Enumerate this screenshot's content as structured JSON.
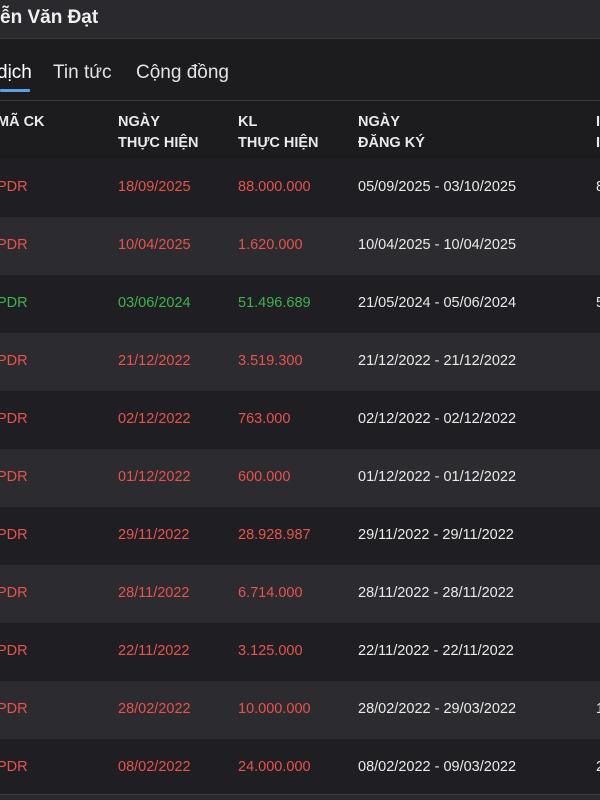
{
  "header": {
    "title": "ễn Văn Đạt"
  },
  "tabs": [
    {
      "label": "dịch",
      "active": true
    },
    {
      "label": "Tin tức",
      "active": false
    },
    {
      "label": "Cộng đồng",
      "active": false
    }
  ],
  "table": {
    "columns": [
      {
        "line1": "MÃ CK",
        "line2": ""
      },
      {
        "line1": "NGÀY",
        "line2": "THỰC HIỆN"
      },
      {
        "line1": "KL",
        "line2": "THỰC HIỆN"
      },
      {
        "line1": "NGÀY",
        "line2": "ĐĂNG KÝ"
      },
      {
        "line1": "I",
        "line2": "I"
      }
    ],
    "rows": [
      {
        "code": "PDR",
        "date": "18/09/2025",
        "volume": "88.000.000",
        "registration": "05/09/2025 - 03/10/2025",
        "extra": "8",
        "status": "red"
      },
      {
        "code": "PDR",
        "date": "10/04/2025",
        "volume": "1.620.000",
        "registration": "10/04/2025 - 10/04/2025",
        "extra": "",
        "status": "red"
      },
      {
        "code": "PDR",
        "date": "03/06/2024",
        "volume": "51.496.689",
        "registration": "21/05/2024 - 05/06/2024",
        "extra": "5",
        "status": "green"
      },
      {
        "code": "PDR",
        "date": "21/12/2022",
        "volume": "3.519.300",
        "registration": "21/12/2022 - 21/12/2022",
        "extra": "",
        "status": "red"
      },
      {
        "code": "PDR",
        "date": "02/12/2022",
        "volume": "763.000",
        "registration": "02/12/2022 - 02/12/2022",
        "extra": "",
        "status": "red"
      },
      {
        "code": "PDR",
        "date": "01/12/2022",
        "volume": "600.000",
        "registration": "01/12/2022 - 01/12/2022",
        "extra": "",
        "status": "red"
      },
      {
        "code": "PDR",
        "date": "29/11/2022",
        "volume": "28.928.987",
        "registration": "29/11/2022 - 29/11/2022",
        "extra": "",
        "status": "red"
      },
      {
        "code": "PDR",
        "date": "28/11/2022",
        "volume": "6.714.000",
        "registration": "28/11/2022 - 28/11/2022",
        "extra": "",
        "status": "red"
      },
      {
        "code": "PDR",
        "date": "22/11/2022",
        "volume": "3.125.000",
        "registration": "22/11/2022 - 22/11/2022",
        "extra": "",
        "status": "red"
      },
      {
        "code": "PDR",
        "date": "28/02/2022",
        "volume": "10.000.000",
        "registration": "28/02/2022 - 29/03/2022",
        "extra": "1",
        "status": "red"
      },
      {
        "code": "PDR",
        "date": "08/02/2022",
        "volume": "24.000.000",
        "registration": "08/02/2022 - 09/03/2022",
        "extra": "2",
        "status": "red"
      }
    ]
  },
  "colors": {
    "background": "#1c1c1f",
    "row_alt": "#2b2b30",
    "sell_red": "#e8534c",
    "buy_green": "#3fb24a",
    "tab_accent": "#5aa2e8"
  }
}
